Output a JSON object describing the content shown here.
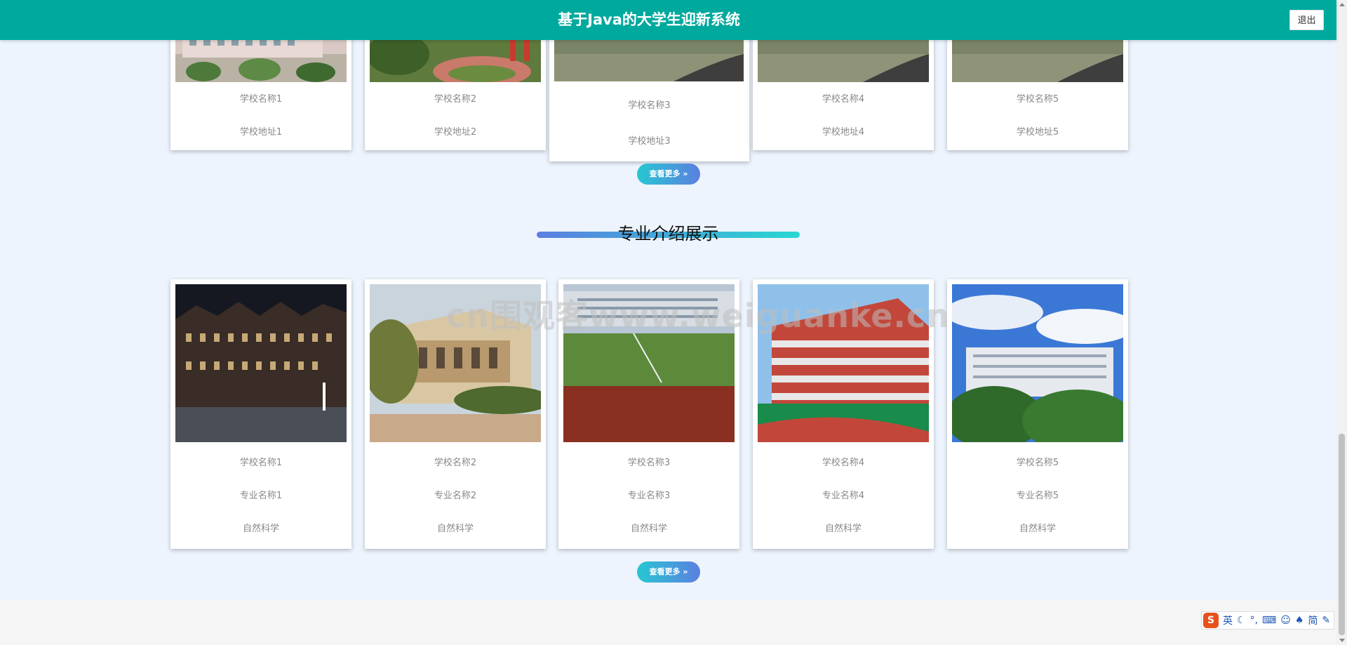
{
  "header": {
    "title": "基于Java的大学生迎新系统",
    "logout_label": "退出",
    "color": "#00a99d"
  },
  "school_section": {
    "cards": [
      {
        "name": "学校名称1",
        "address": "学校地址1"
      },
      {
        "name": "学校名称2",
        "address": "学校地址2"
      },
      {
        "name": "学校名称3",
        "address": "学校地址3"
      },
      {
        "name": "学校名称4",
        "address": "学校地址4"
      },
      {
        "name": "学校名称5",
        "address": "学校地址5"
      }
    ],
    "more_label": "查看更多 »"
  },
  "major_section": {
    "title": "专业介绍展示",
    "cards": [
      {
        "school": "学校名称1",
        "major": "专业名称1",
        "category": "自然科学"
      },
      {
        "school": "学校名称2",
        "major": "专业名称2",
        "category": "自然科学"
      },
      {
        "school": "学校名称3",
        "major": "专业名称3",
        "category": "自然科学"
      },
      {
        "school": "学校名称4",
        "major": "专业名称4",
        "category": "自然科学"
      },
      {
        "school": "学校名称5",
        "major": "专业名称5",
        "category": "自然科学"
      }
    ],
    "more_label": "查看更多 »"
  },
  "watermark": "cn围观客www.weiguanke.cn",
  "ime": {
    "logo": "S",
    "mode": "英",
    "simplified": "简"
  }
}
